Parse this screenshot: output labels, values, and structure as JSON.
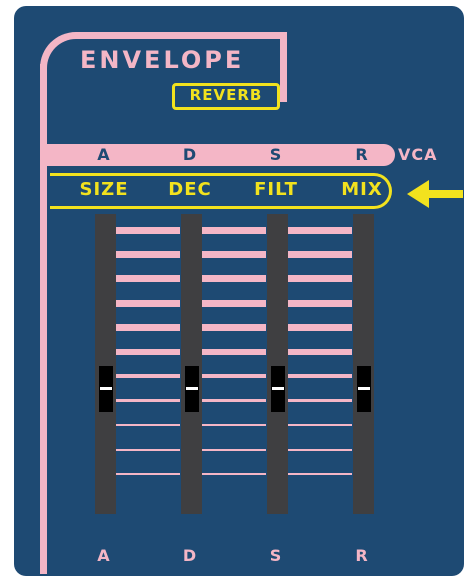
{
  "panel": {
    "title": "ENVELOPE",
    "mode_label": "REVERB",
    "top_row": [
      "A",
      "D",
      "S",
      "R"
    ],
    "top_row_suffix": "VCA",
    "fx_row": [
      "SIZE",
      "DEC",
      "FILT",
      "MIX"
    ],
    "bottom_row": [
      "A",
      "D",
      "S",
      "R"
    ],
    "faders": [
      {
        "param": "A",
        "level": 0.4
      },
      {
        "param": "D",
        "level": 0.4
      },
      {
        "param": "S",
        "level": 0.4
      },
      {
        "param": "R",
        "level": 0.4
      }
    ]
  },
  "colors": {
    "panel_bg": "#1e4a73",
    "pink": "#f4b6c6",
    "yellow": "#f2e21e",
    "track": "#3f3f41"
  }
}
